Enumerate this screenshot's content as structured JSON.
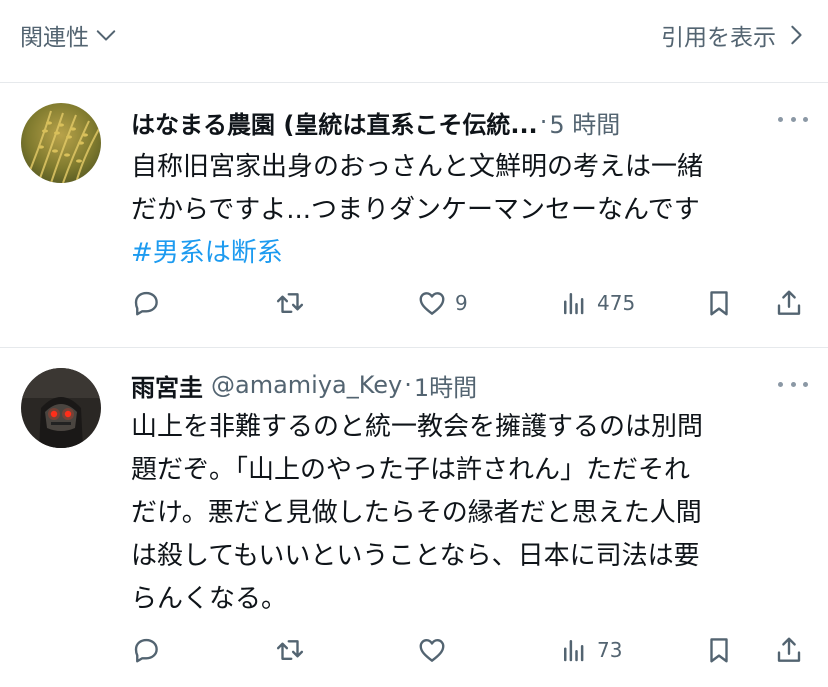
{
  "header": {
    "related_label": "関連性",
    "quotes_label": "引用を表示"
  },
  "tweets": [
    {
      "display_name": "はなまる農園 (皇統は直系こそ伝統...",
      "handle": "",
      "separator": "·",
      "time": "5 時間",
      "body_lines": [
        "自称旧宮家出身のおっさんと文鮮明の考えは一緒",
        "だからですよ...つまりダンケーマンセーなんです"
      ],
      "hashtag": "#男系は断系",
      "replies": "",
      "retweets": "",
      "likes": "9",
      "views": "475",
      "avatar_icon": "rice-plant-avatar"
    },
    {
      "display_name": "雨宮圭",
      "handle": "@amamiya_Key",
      "separator": "·",
      "time": "1時間",
      "body_lines": [
        "山上を非難するのと統一教会を擁護するのは別問",
        "題だぞ。「山上のやった子は許されん」ただそれ",
        "だけ。悪だと見做したらその縁者だと思えた人間",
        "は殺してもいいということなら、日本に司法は要",
        "らんくなる。"
      ],
      "hashtag": "",
      "replies": "",
      "retweets": "",
      "likes": "",
      "views": "73",
      "avatar_icon": "dark-figure-avatar"
    }
  ],
  "icons": {
    "reply": "reply-icon",
    "retweet": "retweet-icon",
    "like": "heart-icon",
    "views": "views-icon",
    "bookmark": "bookmark-icon",
    "share": "share-icon"
  },
  "colors": {
    "secondary_text": "#536471",
    "hashtag": "#1d9bf0",
    "divider": "#e6e9ec"
  }
}
